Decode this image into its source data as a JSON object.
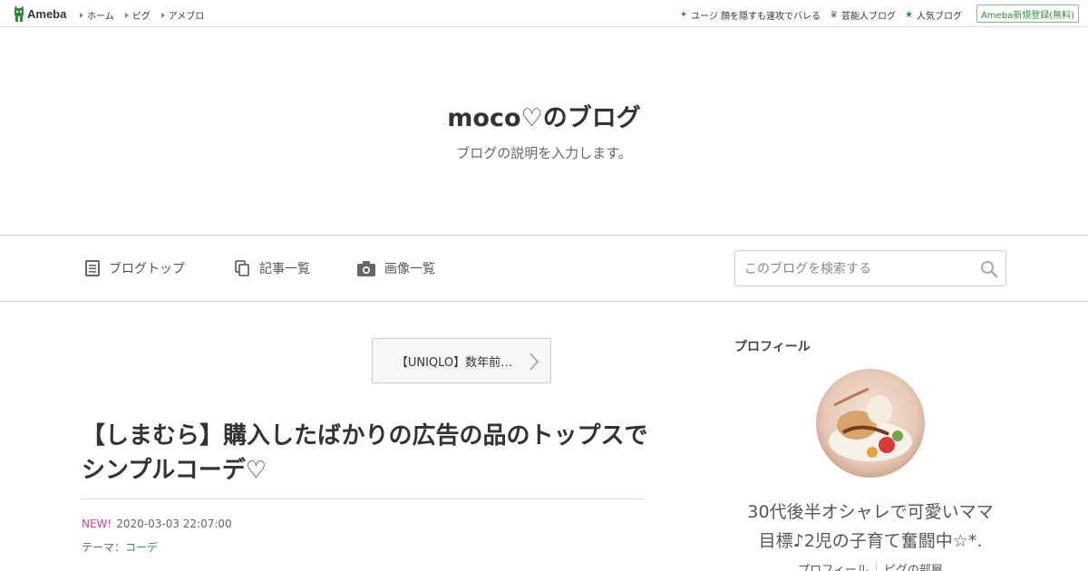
{
  "topbar": {
    "logo_text": "Ameba",
    "left_links": [
      "ホーム",
      "ピグ",
      "アメブロ"
    ],
    "right_links": [
      {
        "label": "ユージ 顔を隠すも速攻でバレる",
        "icon": "sparkle-icon"
      },
      {
        "label": "芸能人ブログ",
        "icon": "crown-icon"
      },
      {
        "label": "人気ブログ",
        "icon": "star-icon"
      }
    ],
    "register_label": "Ameba新規登録(無料)"
  },
  "header": {
    "title": "moco♡のブログ",
    "description": "ブログの説明を入力します。"
  },
  "nav": {
    "items": [
      {
        "label": "ブログトップ",
        "icon": "document-icon"
      },
      {
        "label": "記事一覧",
        "icon": "copy-icon"
      },
      {
        "label": "画像一覧",
        "icon": "camera-icon"
      }
    ],
    "search_placeholder": "このブログを検索する"
  },
  "article": {
    "prev_label": "【UNIQLO】数年前…",
    "title": "【しまむら】購入したばかりの広告の品のトップスでシンプルコーデ♡",
    "new_label": "NEW!",
    "datetime": "2020-03-03 22:07:00",
    "theme_prefix": "テーマ：",
    "theme": "コーデ"
  },
  "sidebar": {
    "heading": "プロフィール",
    "profile_line1": "30代後半オシャレで可愛いママ",
    "profile_line2": "目標♪2児の子育て奮闘中☆*.",
    "links": [
      "プロフィール",
      "ピグの部屋"
    ]
  },
  "colors": {
    "ameba_green": "#2e8b3b",
    "new_pink": "#c63fa0",
    "link_blue": "#3a74c4"
  }
}
